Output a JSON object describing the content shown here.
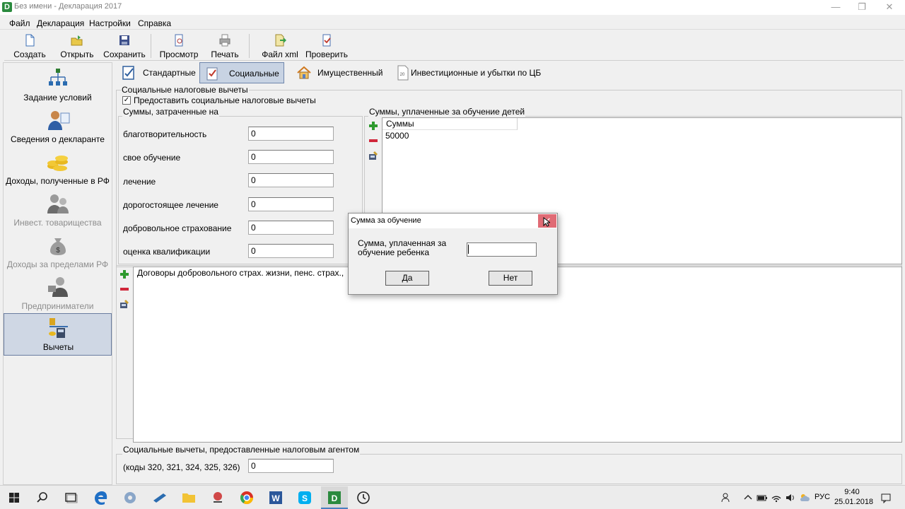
{
  "window": {
    "title": "Без имени - Декларация 2017",
    "app_icon_letter": "D",
    "minimize": "—",
    "maximize": "❐",
    "close": "✕"
  },
  "menu": [
    "Файл",
    "Декларация",
    "Настройки",
    "Справка"
  ],
  "toolbar": {
    "create": "Создать",
    "open": "Открыть",
    "save": "Сохранить",
    "preview": "Просмотр",
    "print": "Печать",
    "xml_file": "Файл xml",
    "check": "Проверить"
  },
  "sidebar": {
    "items": [
      {
        "label": "Задание условий",
        "enabled": true
      },
      {
        "label": "Сведения о декларанте",
        "enabled": true
      },
      {
        "label": "Доходы, полученные в РФ",
        "enabled": true
      },
      {
        "label": "Инвест. товарищества",
        "enabled": false
      },
      {
        "label": "Доходы за пределами РФ",
        "enabled": false
      },
      {
        "label": "Предприниматели",
        "enabled": false
      },
      {
        "label": "Вычеты",
        "enabled": true,
        "active": true
      }
    ]
  },
  "tabs": [
    {
      "label": "Стандартные"
    },
    {
      "label": "Социальные",
      "active": true
    },
    {
      "label": "Имущественный"
    },
    {
      "label": "Инвестиционные и убытки по ЦБ"
    }
  ],
  "tab_icon_text": "20",
  "social": {
    "group_title": "Социальные налоговые вычеты",
    "provide_checkbox_label": "Предоставить социальные налоговые вычеты",
    "provide_checked": true,
    "check_mark": "✓",
    "spent_group_title": "Суммы, затраченные на",
    "fields": [
      {
        "label": "благотворительность",
        "value": "0"
      },
      {
        "label": "свое обучение",
        "value": "0"
      },
      {
        "label": "лечение",
        "value": "0"
      },
      {
        "label": "дорогостоящее лечение",
        "value": "0"
      },
      {
        "label": "добровольное страхование",
        "value": "0"
      },
      {
        "label": "оценка квалификации",
        "value": "0"
      }
    ],
    "children_group_title": "Суммы, уплаченные за обучение детей",
    "children_table": {
      "header": "Суммы",
      "rows": [
        "50000"
      ]
    },
    "contracts_header": "Договоры добровольного страх. жизни, пенс. страх., не",
    "agent_group_title": "Социальные вычеты, предоставленные налоговым агентом",
    "agent_codes_label": "(коды 320, 321, 324, 325, 326)",
    "agent_value": "0"
  },
  "dialog": {
    "title": "Сумма за обучение",
    "close": "✕",
    "field_label_line1": "Сумма, уплаченная за",
    "field_label_line2": "обучение ребенка",
    "field_value": "",
    "yes": "Да",
    "no": "Нет"
  },
  "taskbar": {
    "lang": "РУС",
    "time": "9:40",
    "date": "25.01.2018"
  }
}
